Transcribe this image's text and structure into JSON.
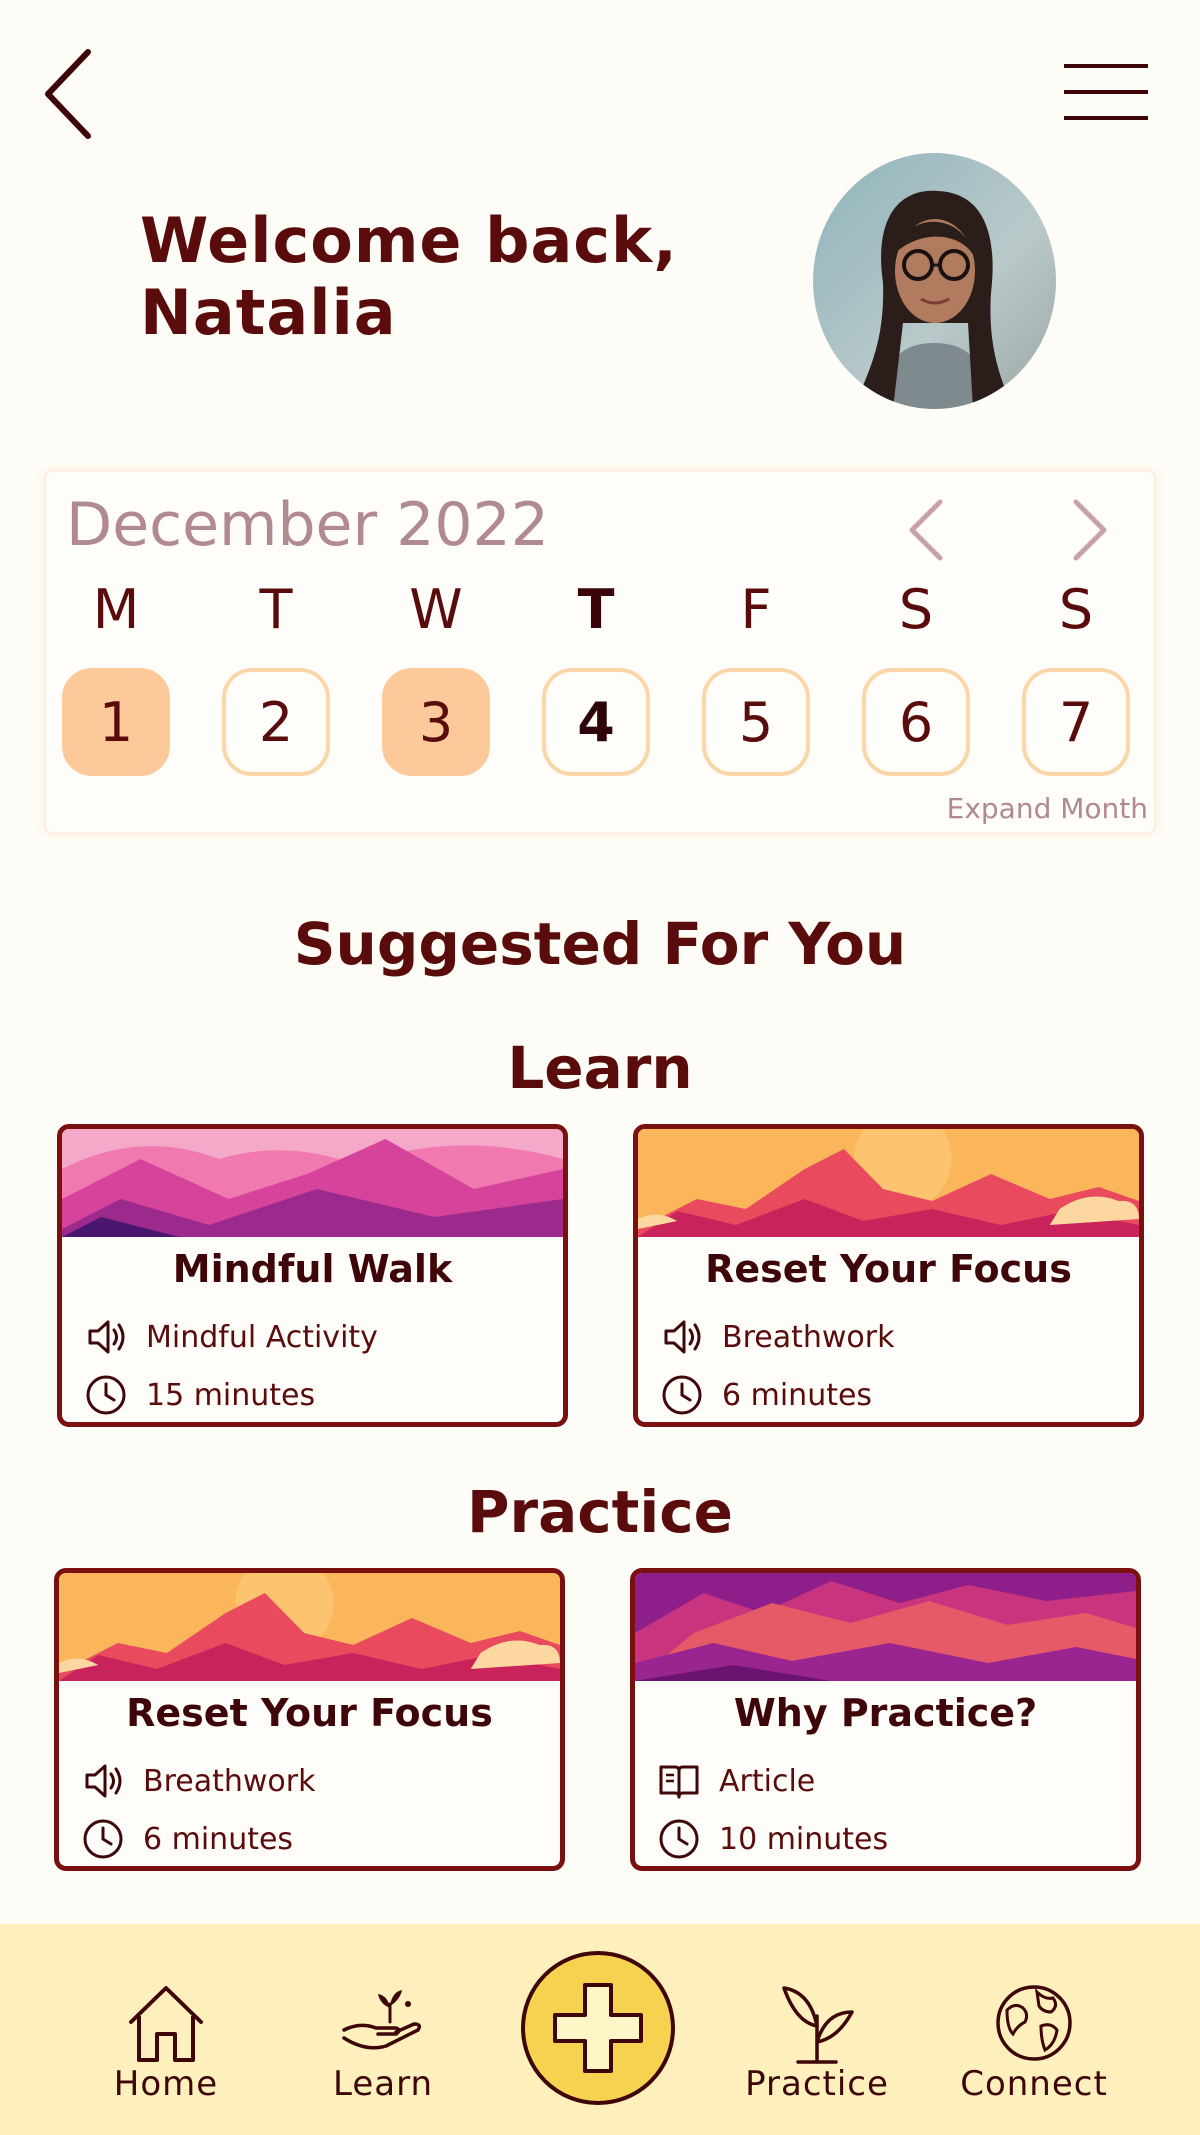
{
  "header": {
    "back_icon": "chevron-left-icon",
    "menu_icon": "hamburger-menu-icon",
    "welcome_line1": "Welcome back,",
    "welcome_line2": "Natalia"
  },
  "calendar": {
    "month_label": "December 2022",
    "prev_icon": "chevron-left-icon",
    "next_icon": "chevron-right-icon",
    "day_names": [
      "M",
      "T",
      "W",
      "T",
      "F",
      "S",
      "S"
    ],
    "dates": [
      "1",
      "2",
      "3",
      "4",
      "5",
      "6",
      "7"
    ],
    "completed_dates": [
      "1",
      "3"
    ],
    "today": "4",
    "expand_label": "Expand Month"
  },
  "suggested_title": "Suggested For You",
  "learn": {
    "title": "Learn",
    "cards": [
      {
        "title": "Mindful Walk",
        "type_icon": "speaker-icon",
        "type": "Mindful Activity",
        "duration": "15 minutes"
      },
      {
        "title": "Reset Your Focus",
        "type_icon": "speaker-icon",
        "type": "Breathwork",
        "duration": "6 minutes"
      }
    ]
  },
  "practice": {
    "title": "Practice",
    "cards": [
      {
        "title": "Reset Your Focus",
        "type_icon": "speaker-icon",
        "type": "Breathwork",
        "duration": "6 minutes"
      },
      {
        "title": "Why Practice?",
        "type_icon": "book-icon",
        "type": "Article",
        "duration": "10 minutes"
      }
    ]
  },
  "nav": {
    "home": "Home",
    "learn": "Learn",
    "add_icon": "plus-icon",
    "practice": "Practice",
    "connect": "Connect"
  },
  "colors": {
    "background": "#fefcf6",
    "text_primary": "#5a0c0c",
    "date_filled": "#fcc99a",
    "date_border": "#fcd6a8",
    "nav_bg": "#fdf0bd",
    "add_button": "#f5d24f"
  }
}
